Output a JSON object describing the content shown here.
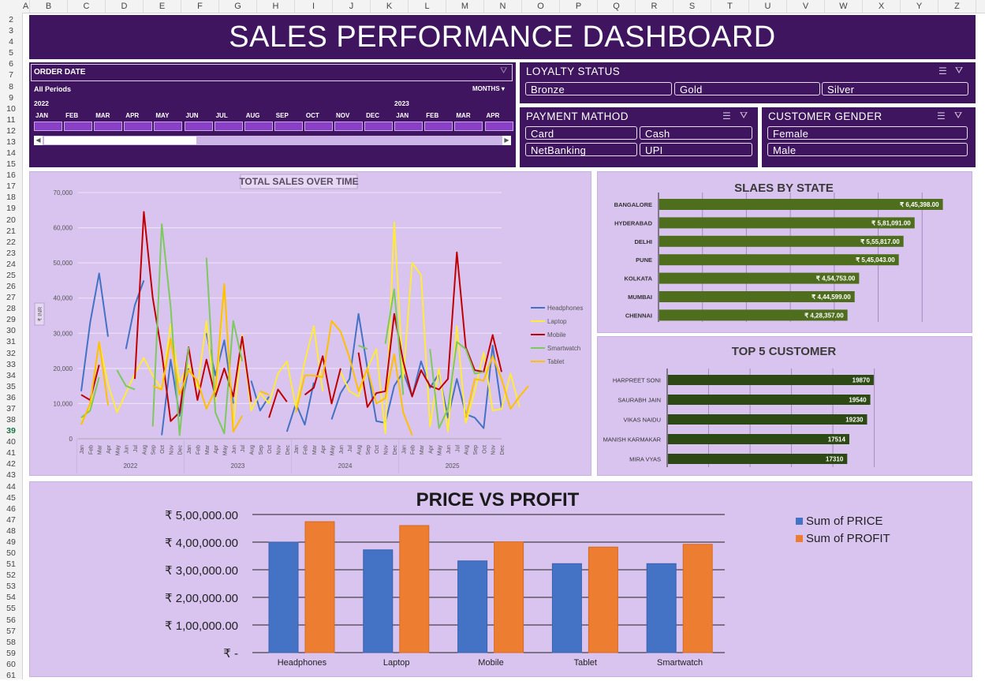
{
  "sheet": {
    "columns": [
      "A",
      "B",
      "C",
      "D",
      "E",
      "F",
      "G",
      "H",
      "I",
      "J",
      "K",
      "L",
      "M",
      "N",
      "O",
      "P",
      "Q",
      "R",
      "S",
      "T",
      "U",
      "V",
      "W",
      "X",
      "Y",
      "Z"
    ],
    "rows": [
      "2",
      "3",
      "4",
      "5",
      "6",
      "7",
      "8",
      "9",
      "10",
      "11",
      "12",
      "13",
      "14",
      "15",
      "16",
      "17",
      "18",
      "19",
      "20",
      "21",
      "22",
      "23",
      "24",
      "25",
      "26",
      "27",
      "28",
      "29",
      "30",
      "31",
      "32",
      "33",
      "34",
      "35",
      "36",
      "37",
      "38",
      "39",
      "40",
      "41",
      "42",
      "43",
      "44",
      "45",
      "46",
      "47",
      "48",
      "49",
      "50",
      "51",
      "52",
      "53",
      "54",
      "55",
      "56",
      "57",
      "58",
      "59",
      "60",
      "61"
    ],
    "selected_row": "39"
  },
  "dashboard_title": "SALES PERFORMANCE DASHBOARD",
  "timeline": {
    "title": "ORDER DATE",
    "periods_label": "All Periods",
    "level_label": "MONTHS",
    "years": [
      "2022",
      "2023"
    ],
    "months": [
      "JAN",
      "FEB",
      "MAR",
      "APR",
      "MAY",
      "JUN",
      "JUL",
      "AUG",
      "SEP",
      "OCT",
      "NOV",
      "DEC",
      "JAN",
      "FEB",
      "MAR",
      "APR"
    ]
  },
  "loyalty_slicer": {
    "title": "LOYALTY STATUS",
    "items": [
      "Bronze",
      "Gold",
      "Silver"
    ]
  },
  "payment_slicer": {
    "title": "PAYMENT MATHOD",
    "items": [
      "Card",
      "Cash",
      "NetBanking",
      "UPI"
    ]
  },
  "gender_slicer": {
    "title": "CUSTOMER GENDER",
    "items": [
      "Female",
      "Male"
    ]
  },
  "icons": {
    "multi_select": "multi-select-icon",
    "clear_filter": "clear-filter-icon",
    "scroll_left": "scroll-left-icon",
    "scroll_right": "scroll-right-icon"
  },
  "chart_data": [
    {
      "type": "line",
      "title": "TOTAL SALES OVER TIME",
      "ylabel": "₹ INR",
      "ylim": [
        0,
        70000
      ],
      "yticks": [
        "0",
        "10,000",
        "20,000",
        "30,000",
        "40,000",
        "50,000",
        "60,000",
        "70,000"
      ],
      "month_labels": [
        "Jan",
        "Feb",
        "Mar",
        "Apr",
        "May",
        "Jun",
        "Jul",
        "Aug",
        "Sep",
        "Oct",
        "Nov",
        "Dec"
      ],
      "years": [
        "2022",
        "2023",
        "2024",
        "2025"
      ],
      "legend_position": "right",
      "series": [
        {
          "name": "Headphones",
          "color": "#4472c4",
          "values": [
            13500,
            33000,
            47000,
            29000,
            null,
            25500,
            38000,
            45000,
            null,
            1000,
            22500,
            6500,
            20000,
            null,
            30000,
            18000,
            28000,
            10000,
            null,
            16500,
            8000,
            12000,
            null,
            2000,
            10000,
            4000,
            16000,
            null,
            5500,
            13000,
            17000,
            35500,
            20000,
            5000,
            4500,
            15000,
            19000,
            12000,
            22000,
            14500,
            18500,
            6000,
            17000,
            7000,
            6000,
            3000,
            26500,
            8500
          ]
        },
        {
          "name": "Laptop",
          "color": "#ffeb3b",
          "values": [
            5500,
            8500,
            27500,
            15500,
            7500,
            13000,
            18500,
            23000,
            18000,
            14000,
            32500,
            16000,
            21000,
            14500,
            33500,
            10500,
            43500,
            3500,
            29500,
            8000,
            13000,
            10000,
            18500,
            22000,
            9000,
            22000,
            32000,
            13500,
            null,
            19000,
            13500,
            12000,
            20000,
            25500,
            1500,
            61500,
            17000,
            50000,
            46500,
            3500,
            20000,
            2000,
            32000,
            4500,
            13500,
            24500,
            8000,
            8500,
            18500,
            9000
          ]
        },
        {
          "name": "Mobile",
          "color": "#c00000",
          "values": [
            12500,
            11000,
            21000,
            null,
            null,
            null,
            17000,
            64500,
            40000,
            24500,
            5000,
            7500,
            26000,
            11000,
            22500,
            12000,
            20000,
            12000,
            29000,
            10500,
            null,
            6000,
            14000,
            10500,
            null,
            12500,
            14500,
            23500,
            10000,
            20000,
            null,
            24500,
            9000,
            13000,
            13500,
            35500,
            22000,
            12000,
            19500,
            15000,
            14000,
            17000,
            53000,
            26000,
            19500,
            19000,
            29500,
            19000
          ]
        },
        {
          "name": "Smartwatch",
          "color": "#7dc95e",
          "values": [
            6000,
            8000,
            17500,
            null,
            19500,
            15000,
            14000,
            null,
            3500,
            61000,
            37500,
            1000,
            26000,
            null,
            51500,
            7500,
            1500,
            33500,
            22000,
            null,
            null,
            12000,
            null,
            26000,
            null,
            21000,
            null,
            25000,
            null,
            21000,
            null,
            26500,
            25500,
            null,
            27000,
            42500,
            12500,
            null,
            null,
            25500,
            3000,
            8500,
            27500,
            25500,
            18500,
            19000
          ]
        },
        {
          "name": "Tablet",
          "color": "#ffc000",
          "values": [
            4000,
            10000,
            27500,
            9500,
            null,
            null,
            null,
            null,
            15000,
            14000,
            28500,
            12500,
            19500,
            16500,
            8500,
            14000,
            44000,
            2000,
            6500,
            null,
            13500,
            12500,
            null,
            null,
            7500,
            18000,
            18000,
            17500,
            33500,
            30500,
            23000,
            13500,
            20000,
            10000,
            11500,
            24000,
            7500,
            1000,
            null,
            25000,
            null,
            3500,
            null,
            6000,
            17000,
            16500,
            23500,
            17000,
            8500,
            12000,
            15000
          ]
        }
      ]
    },
    {
      "type": "bar",
      "title": "SLAES BY STATE",
      "categories": [
        "BANGALORE",
        "HYDERABAD",
        "DELHI",
        "PUNE",
        "KOLKATA",
        "MUMBAI",
        "CHENNAI"
      ],
      "values": [
        645398,
        581091,
        555817,
        545043,
        454753,
        444599,
        428357
      ],
      "value_labels": [
        "₹ 6,45,398.00",
        "₹ 5,81,091.00",
        "₹ 5,55,817.00",
        "₹ 5,45,043.00",
        "₹ 4,54,753.00",
        "₹ 4,44,599.00",
        "₹ 4,28,357.00"
      ],
      "color": "#4e6e1e"
    },
    {
      "type": "bar",
      "title": "TOP 5 CUSTOMER",
      "categories": [
        "HARPREET SONI",
        "SAURABH JAIN",
        "VIKAS NAIDU",
        "MANISH KARMAKAR",
        "MIRA VYAS"
      ],
      "values": [
        19870,
        19540,
        19230,
        17514,
        17310
      ],
      "value_labels": [
        "19870",
        "19540",
        "19230",
        "17514",
        "17310"
      ],
      "color": "#2d4a14"
    },
    {
      "type": "bar",
      "title": "PRICE VS PROFIT",
      "categories": [
        "Headphones",
        "Laptop",
        "Mobile",
        "Tablet",
        "Smartwatch"
      ],
      "ylim": [
        0,
        500000
      ],
      "yticks": [
        "₹ -",
        "₹ 1,00,000.00",
        "₹ 2,00,000.00",
        "₹ 3,00,000.00",
        "₹ 4,00,000.00",
        "₹ 5,00,000.00"
      ],
      "legend_position": "right",
      "series": [
        {
          "name": "Sum of PRICE",
          "color": "#4472c4",
          "values": [
            400000,
            372000,
            332000,
            322000,
            322000
          ]
        },
        {
          "name": "Sum of PROFIT",
          "color": "#ed7d31",
          "values": [
            474000,
            460000,
            401000,
            382000,
            392000
          ]
        }
      ]
    }
  ]
}
